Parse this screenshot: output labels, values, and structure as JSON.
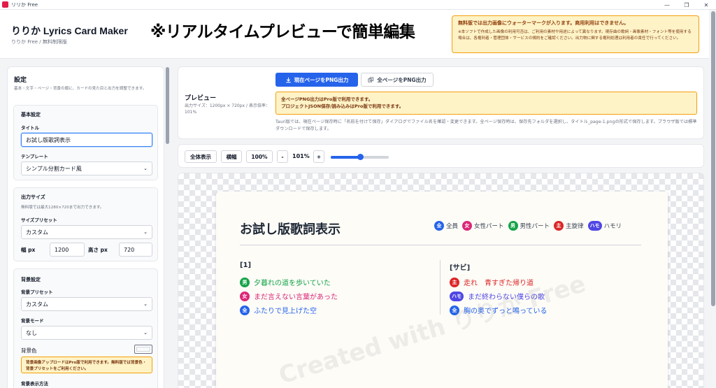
{
  "window": {
    "title": "リリか Free",
    "controls": [
      "—",
      "❐",
      "✕"
    ]
  },
  "header": {
    "app_name": "りりか Lyrics Card Maker",
    "app_sub": "りりか Free / 無料制限版",
    "banner": "※リアルタイムプレビューで簡単編集",
    "notice_title": "無料版では出力画像にウォーターマークが入ります。商用利用はできません。",
    "notice_body": "※本ソフトで作成した画像の利用可否は、ご利用の素材や用途によって異なります。現存曲の歌詞・画像素材・フォント等を使用する場合は、各権利者・管理団体・サービスの規約をご確認ください。出力物に関する権利処理は利用者の責任で行ってください。"
  },
  "settings": {
    "title": "設定",
    "desc": "基本・文字・ページ・背景の順に、カードの見た目と出力を調整できます。",
    "basic": {
      "title": "基本設定",
      "title_label": "タイトル",
      "title_value": "お試し版歌詞表示",
      "template_label": "テンプレート",
      "template_value": "シンプル分割カード風"
    },
    "output": {
      "title": "出力サイズ",
      "hint": "無料版では最大1280×720まで出力できます。",
      "preset_label": "サイズプリセット",
      "preset_value": "カスタム",
      "width_label": "幅 px",
      "width_value": "1200",
      "height_label": "高さ px",
      "height_value": "720"
    },
    "background": {
      "title": "背景設定",
      "preset_label": "背景プリセット",
      "preset_value": "カスタム",
      "mode_label": "背景モード",
      "mode_value": "なし",
      "color_label": "背景色",
      "color_value": "#f9fafb",
      "warn": "背景画像アップロードはPro版で利用できます。無料版では背景色・背景プリセットをご利用ください。",
      "display_label": "背景表示方法"
    }
  },
  "preview": {
    "title": "プレビュー",
    "size_text": "出力サイズ：1200px × 720px / 表示倍率：101%",
    "btn_current": "現在ページをPNG出力",
    "btn_all": "全ページをPNG出力",
    "pro_note_1": "全ページPNG出力はPro版で利用できます。",
    "pro_note_2": "プロジェクトJSON保存/読み込みはPro版で利用できます。",
    "tauri_note": "Tauri版では、現在ページ保存時に「名前を付けて保存」ダイアログでファイル名を確認・変更できます。全ページ保存時は、保存先フォルダを選択し、タイトル_page-1.pngの形式で保存します。ブラウザ版では標準ダウンロードで保存します。"
  },
  "zoom": {
    "fit": "全体表示",
    "width": "横幅",
    "hundred": "100%",
    "minus": "-",
    "value": "101%",
    "plus": "+",
    "slider_fraction": 0.5
  },
  "card": {
    "title": "お試し版歌詞表示",
    "legend": [
      {
        "badge": "全",
        "label": "全員",
        "color": "#2563eb"
      },
      {
        "badge": "女",
        "label": "女性パート",
        "color": "#db2777"
      },
      {
        "badge": "男",
        "label": "男性パート",
        "color": "#16a34a"
      },
      {
        "badge": "主",
        "label": "主旋律",
        "color": "#dc2626"
      },
      {
        "badge": "ハモ",
        "label": "ハモリ",
        "color": "#4f46e5"
      }
    ],
    "left_head": "[1]",
    "left_lines": [
      {
        "badge": "男",
        "text": "夕暮れの道を歩いていた",
        "color": "#16a34a"
      },
      {
        "badge": "女",
        "text": "まだ言えない言葉があった",
        "color": "#db2777"
      },
      {
        "badge": "全",
        "text": "ふたりで見上げた空",
        "color": "#2563eb"
      }
    ],
    "right_head": "[サビ]",
    "right_lines": [
      {
        "badge": "主",
        "text": "走れ　青すぎた帰り道",
        "color": "#dc2626"
      },
      {
        "badge": "ハモ",
        "text": "まだ終わらない僕らの歌",
        "color": "#4f46e5"
      },
      {
        "badge": "全",
        "text": "胸の奥でずっと鳴っている",
        "color": "#2563eb"
      }
    ],
    "watermark": "Created with りりか Free"
  }
}
